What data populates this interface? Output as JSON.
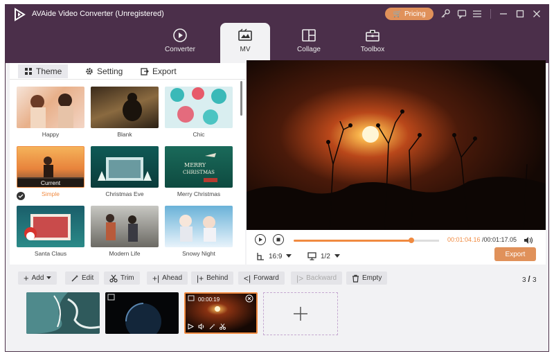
{
  "app": {
    "title": "AVAide Video Converter (Unregistered)",
    "pricing_label": "Pricing"
  },
  "nav": {
    "tabs": [
      {
        "label": "Converter",
        "icon": "converter-icon"
      },
      {
        "label": "MV",
        "icon": "mv-icon",
        "active": true
      },
      {
        "label": "Collage",
        "icon": "collage-icon"
      },
      {
        "label": "Toolbox",
        "icon": "toolbox-icon"
      }
    ]
  },
  "subtabs": [
    {
      "label": "Theme",
      "active": true
    },
    {
      "label": "Setting"
    },
    {
      "label": "Export"
    }
  ],
  "themes": [
    {
      "label": "Happy"
    },
    {
      "label": "Blank"
    },
    {
      "label": "Chic"
    },
    {
      "label": "Simple",
      "selected": true,
      "badge": "Current"
    },
    {
      "label": "Christmas Eve"
    },
    {
      "label": "Merry Christmas"
    },
    {
      "label": "Santa Claus"
    },
    {
      "label": "Modern Life"
    },
    {
      "label": "Snowy Night"
    }
  ],
  "player": {
    "current_time": "00:01:04.16",
    "total_time": "/00:01:17.05",
    "progress": 0.83,
    "aspect_ratio": "16:9",
    "page": "1/2",
    "export_label": "Export"
  },
  "toolbar": {
    "add": "Add",
    "edit": "Edit",
    "trim": "Trim",
    "ahead": "Ahead",
    "behind": "Behind",
    "forward": "Forward",
    "backward": "Backward",
    "empty": "Empty",
    "count_current": "3",
    "count_total": "3"
  },
  "timeline": {
    "active_clip_duration": "00:00:19"
  },
  "colors": {
    "brand": "#4b2f4a",
    "accent": "#e0915a",
    "progress": "#f08a40"
  }
}
